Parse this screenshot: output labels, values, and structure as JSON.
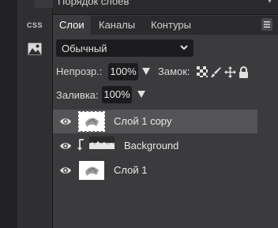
{
  "header": {
    "title": "Порядок слоев"
  },
  "toolbar": {
    "css_label": "CSS"
  },
  "tabs": [
    {
      "label": "Слои",
      "active": true
    },
    {
      "label": "Каналы",
      "active": false
    },
    {
      "label": "Контуры",
      "active": false
    }
  ],
  "blend_mode": {
    "value": "Обычный"
  },
  "opacity": {
    "label": "Непрозр.:",
    "value": "100%"
  },
  "lock": {
    "label": "Замок:"
  },
  "fill": {
    "label": "Заливка:",
    "value": "100%"
  },
  "layers": [
    {
      "name": "Слой 1 copy",
      "selected": true
    },
    {
      "name": "Background",
      "selected": false
    },
    {
      "name": "Слой 1",
      "selected": false
    }
  ],
  "colors": {
    "panel": "#3b3b3d",
    "selected_row": "#545456",
    "field": "#1c1c1e"
  }
}
